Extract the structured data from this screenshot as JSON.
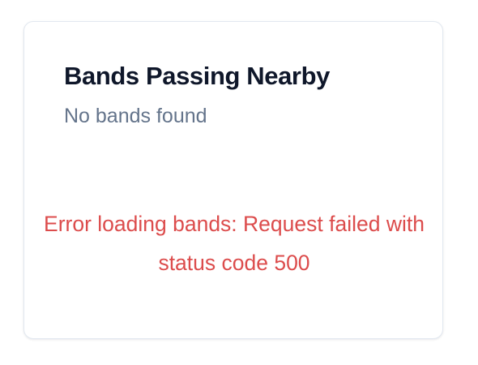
{
  "card": {
    "title": "Bands Passing Nearby",
    "empty_state": "No bands found",
    "error_message": "Error loading bands: Request failed with status code 500"
  },
  "colors": {
    "title": "#0f172a",
    "subtitle": "#64748b",
    "error": "#dc4c4c",
    "card_border": "#e2e8f0",
    "background": "#ffffff"
  }
}
